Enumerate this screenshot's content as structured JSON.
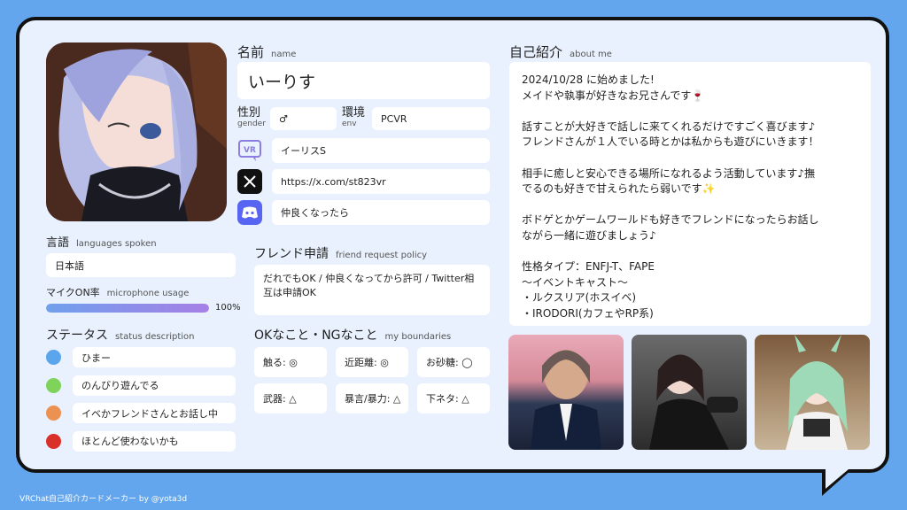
{
  "profile": {
    "name_label": "名前",
    "name_label_en": "name",
    "name": "いーりす",
    "gender_label": "性別",
    "gender_label_en": "gender",
    "gender": "♂",
    "env_label": "環境",
    "env_label_en": "env",
    "env": "PCVR",
    "vrchat_id": "イーリスS",
    "x_url": "https://x.com/st823vr",
    "discord": "仲良くなったら"
  },
  "languages": {
    "label": "言語",
    "label_en": "languages spoken",
    "value": "日本語"
  },
  "microphone": {
    "label": "マイクON率",
    "label_en": "microphone usage",
    "percent_text": "100%",
    "level": 1.0
  },
  "status": {
    "label": "ステータス",
    "label_en": "status description",
    "items": [
      {
        "text": "ひまー",
        "color": "#5aa5ec"
      },
      {
        "text": "のんびり遊んでる",
        "color": "#7fd35b"
      },
      {
        "text": "イベかフレンドさんとお話し中",
        "color": "#eb9152"
      },
      {
        "text": "ほとんど使わないかも",
        "color": "#d9302a"
      }
    ]
  },
  "friend_request": {
    "label": "フレンド申請",
    "label_en": "friend request policy",
    "text": "だれでもOK / 仲良くなってから許可 / Twitter相互は申請OK"
  },
  "boundaries": {
    "label": "OKなこと・NGなこと",
    "label_en": "my boundaries",
    "items": [
      "触る: ◎",
      "近距離: ◎",
      "お砂糖: ◯",
      "武器: △",
      "暴言/暴力: △",
      "下ネタ: △"
    ]
  },
  "about": {
    "label": "自己紹介",
    "label_en": "about me",
    "lines": [
      "2024/10/28 に始めました!",
      "メイドや執事が好きなお兄さんです🍷",
      "",
      "話すことが大好きで話しに来てくれるだけですごく喜びます♪",
      "フレンドさんが１人でいる時とかは私からも遊びにいきます！",
      "",
      "相手に癒しと安心できる場所になれるよう活動しています♪撫",
      "でるのも好きで甘えられたら弱いです✨",
      "",
      "ボドゲとかゲームワールドも好きでフレンドになったらお話し",
      "ながら一緒に遊びましょう♪",
      "",
      "性格タイプ：ENFJ-T、FAPE",
      "〜イベントキャスト〜",
      "・ルクスリア(ホスイベ)",
      "・IRODORI(カフェやRP系)"
    ]
  },
  "footer": "VRChat自己紹介カードメーカー by @yota3d",
  "icons": {
    "vrchat": "vrchat-logo-icon",
    "x": "x-logo-icon",
    "discord": "discord-logo-icon"
  }
}
